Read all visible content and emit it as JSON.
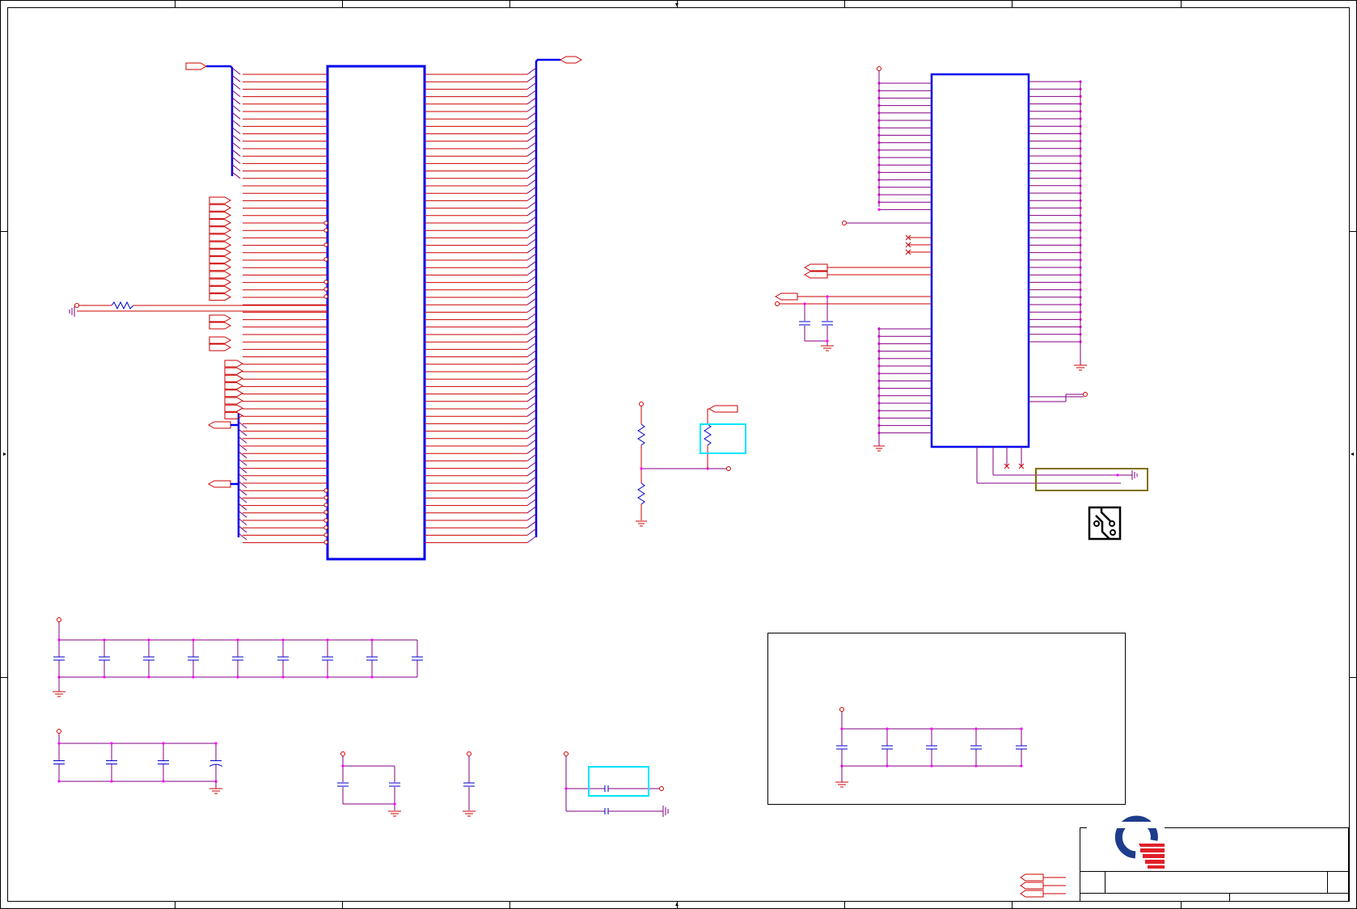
{
  "title_block": {
    "logo": "quanta-logo-icon",
    "text": ""
  },
  "colors": {
    "wire": "#cc0000",
    "bus": "#0000ee",
    "net_purple": "#800080",
    "junction": "#ff00ff",
    "component": "#0000cc",
    "highlight_cyan": "#00e5ff",
    "highlight_olive": "#807000",
    "frame": "#000000"
  },
  "icons": [
    "pcb-trace-icon",
    "quanta-logo-icon",
    "ground-icon",
    "off-page-connector-icon",
    "no-connect-icon"
  ]
}
